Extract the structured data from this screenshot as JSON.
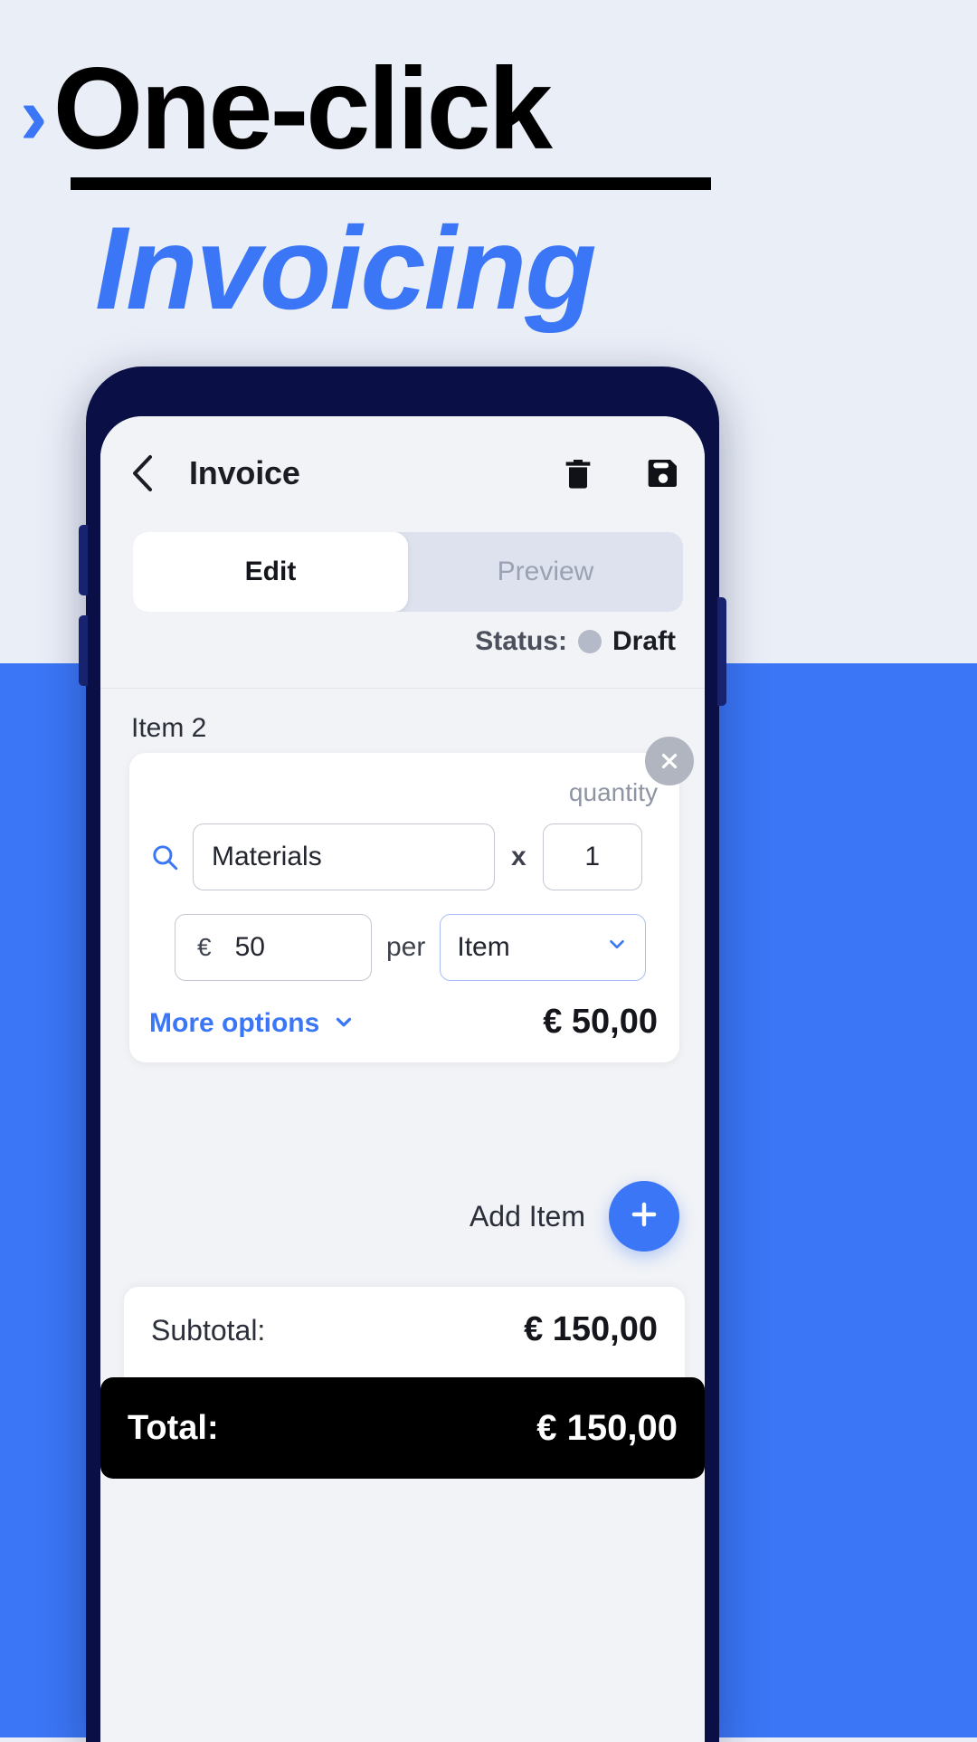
{
  "promo": {
    "chevron_mark": "›",
    "line1": "One-click",
    "line2": "Invoicing",
    "accent_color": "#3b76f6",
    "background_top": "#eaeef7",
    "background_bottom": "#3b76f6"
  },
  "app_bar": {
    "back_icon": "chevron-left-icon",
    "title": "Invoice",
    "delete_icon": "trash-icon",
    "save_icon": "save-floppy-icon"
  },
  "tabs": [
    {
      "label": "Edit",
      "active": true
    },
    {
      "label": "Preview",
      "active": false
    }
  ],
  "status": {
    "label": "Status:",
    "value": "Draft",
    "dot_color": "#b4bac7"
  },
  "item": {
    "section_label": "Item 2",
    "remove_icon": "close-icon",
    "quantity_caption": "quantity",
    "search_icon": "search-icon",
    "description_value": "Materials",
    "multiply_symbol": "x",
    "quantity_value": "1",
    "price_currency": "€",
    "price_value": "50",
    "per_label": "per",
    "unit_value": "Item",
    "unit_chevron_icon": "chevron-down-icon",
    "more_options_label": "More options",
    "more_options_icon": "chevron-down-icon",
    "line_total": "€ 50,00"
  },
  "add_item": {
    "label": "Add Item",
    "icon": "plus-icon",
    "button_color": "#3b76f6"
  },
  "totals": {
    "subtotal_label": "Subtotal:",
    "subtotal_value": "€ 150,00",
    "total_label": "Total:",
    "total_value": "€ 150,00"
  }
}
